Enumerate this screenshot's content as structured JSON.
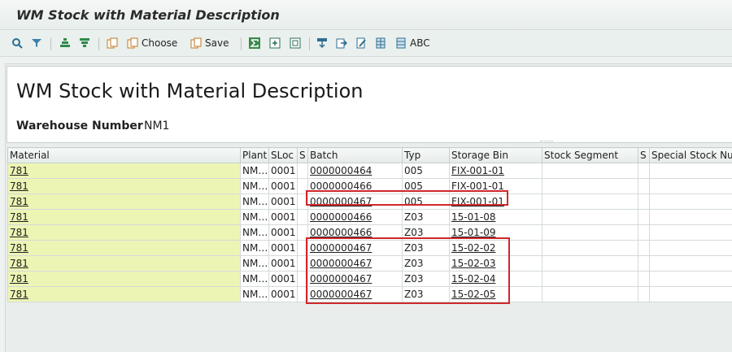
{
  "window": {
    "title": "WM Stock with Material Description"
  },
  "toolbar": {
    "choose_label": "Choose",
    "save_label": "Save",
    "abc_label": "ABC"
  },
  "header": {
    "page_title": "WM Stock with Material Description",
    "warehouse_label": "Warehouse Number",
    "warehouse_value": "NM1"
  },
  "table": {
    "columns": [
      "Material",
      "Plant",
      "SLoc",
      "S",
      "Batch",
      "Typ",
      "Storage Bin",
      "Stock Segment",
      "S",
      "Special Stock Num"
    ],
    "rows": [
      [
        "781",
        "NM…",
        "0001",
        "",
        "0000000464",
        "005",
        "FIX-001-01",
        "",
        "",
        ""
      ],
      [
        "781",
        "NM…",
        "0001",
        "",
        "0000000466",
        "005",
        "FIX-001-01",
        "",
        "",
        ""
      ],
      [
        "781",
        "NM…",
        "0001",
        "",
        "0000000467",
        "005",
        "FIX-001-01",
        "",
        "",
        ""
      ],
      [
        "781",
        "NM…",
        "0001",
        "",
        "0000000466",
        "Z03",
        "15-01-08",
        "",
        "",
        ""
      ],
      [
        "781",
        "NM…",
        "0001",
        "",
        "0000000466",
        "Z03",
        "15-01-09",
        "",
        "",
        ""
      ],
      [
        "781",
        "NM…",
        "0001",
        "",
        "0000000467",
        "Z03",
        "15-02-02",
        "",
        "",
        ""
      ],
      [
        "781",
        "NM…",
        "0001",
        "",
        "0000000467",
        "Z03",
        "15-02-03",
        "",
        "",
        ""
      ],
      [
        "781",
        "NM…",
        "0001",
        "",
        "0000000467",
        "Z03",
        "15-02-04",
        "",
        "",
        ""
      ],
      [
        "781",
        "NM…",
        "0001",
        "",
        "0000000467",
        "Z03",
        "15-02-05",
        "",
        "",
        ""
      ]
    ]
  },
  "colors": {
    "material_cell": "#edf5b5",
    "highlight": "#d0282c"
  }
}
